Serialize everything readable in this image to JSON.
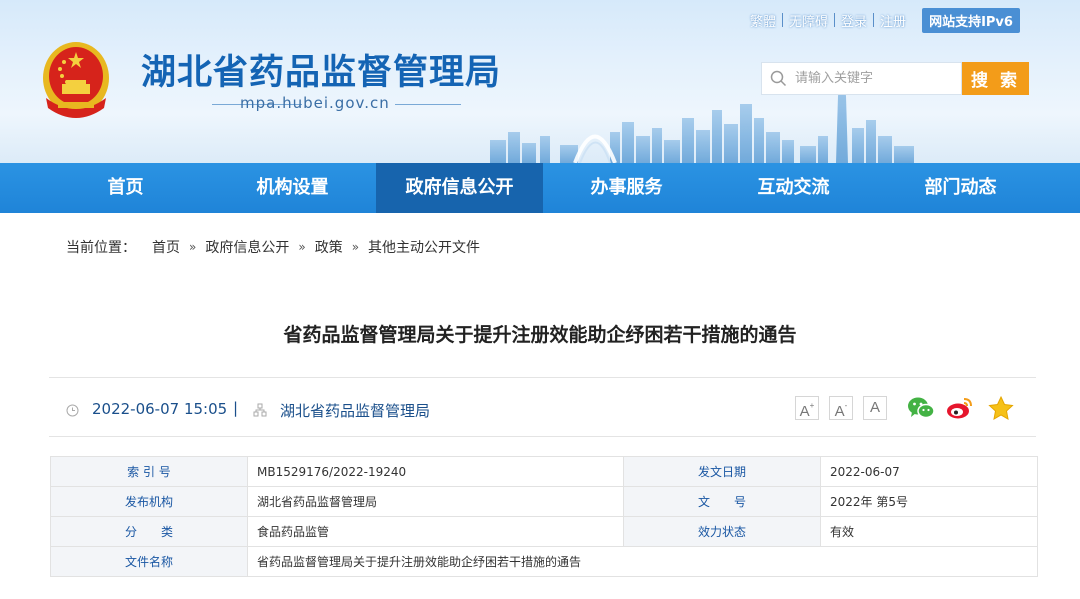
{
  "site": {
    "title": "湖北省药品监督管理局",
    "domain": "mpa.hubei.gov.cn"
  },
  "toplinks": [
    "繁體",
    "无障碍",
    "登录",
    "注册"
  ],
  "ipv6_label": "网站支持IPv6",
  "search": {
    "placeholder": "请输入关键字",
    "button": "搜 索"
  },
  "nav": [
    {
      "label": "首页",
      "active": false
    },
    {
      "label": "机构设置",
      "active": false
    },
    {
      "label": "政府信息公开",
      "active": true
    },
    {
      "label": "办事服务",
      "active": false
    },
    {
      "label": "互动交流",
      "active": false
    },
    {
      "label": "部门动态",
      "active": false
    }
  ],
  "breadcrumb": {
    "label": "当前位置：",
    "items": [
      "首页",
      "政府信息公开",
      "政策",
      "其他主动公开文件"
    ],
    "separator": "»"
  },
  "article": {
    "title": "省药品监督管理局关于提升注册效能助企纾困若干措施的通告",
    "date": "2022-06-07 15:05",
    "separator": "|",
    "org": "湖北省药品监督管理局",
    "font_sizes": [
      "A",
      "A",
      "A"
    ],
    "share_icons": [
      "wechat-icon",
      "weibo-icon",
      "favorite-star-icon"
    ]
  },
  "meta": {
    "index_label": "索 引 号",
    "index_value": "MB1529176/2022-19240",
    "issue_date_label": "发文日期",
    "issue_date_value": "2022-06-07",
    "issuer_label": "发布机构",
    "issuer_value": "湖北省药品监督管理局",
    "doc_no_label": "文　　号",
    "doc_no_value": "2022年 第5号",
    "category_label": "分　　类",
    "category_value": "食品药品监管",
    "status_label": "效力状态",
    "status_value": "有效",
    "filename_label": "文件名称",
    "filename_value": "省药品监督管理局关于提升注册效能助企纾困若干措施的通告"
  },
  "colors": {
    "brand_blue": "#1464b4",
    "nav_blue": "#1f84d8",
    "nav_active": "#1764ad",
    "search_orange": "#f39c19"
  }
}
